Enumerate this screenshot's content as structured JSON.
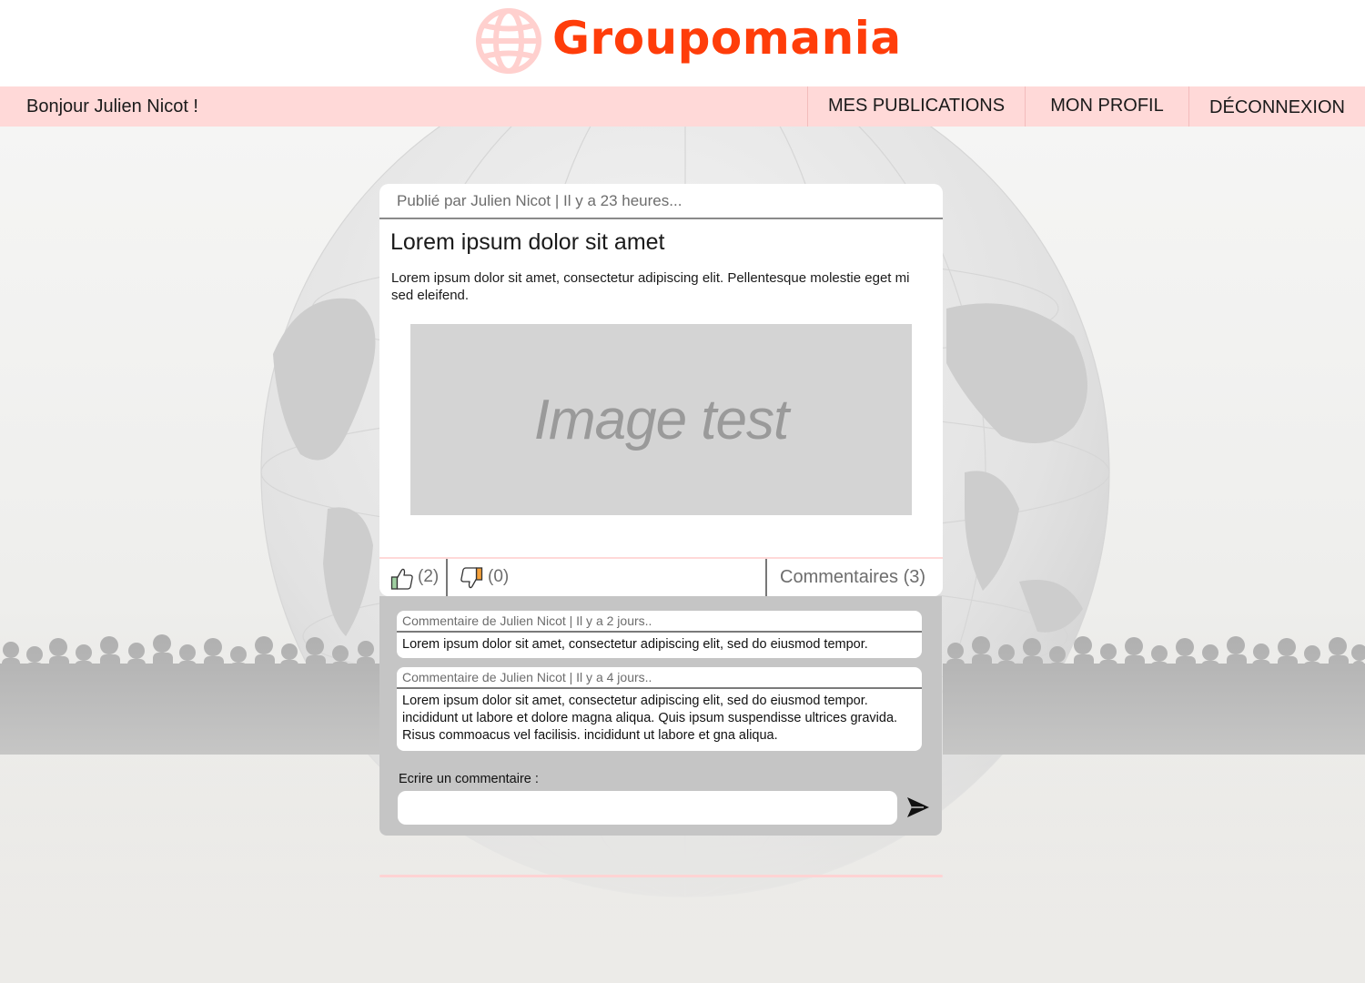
{
  "brand": {
    "name": "Groupomania",
    "accent_color": "#ff3d0a",
    "icon": "globe-icon",
    "icon_color": "#ffd0ce"
  },
  "nav": {
    "greeting": "Bonjour Julien Nicot !",
    "items": [
      {
        "label": "MES PUBLICATIONS"
      },
      {
        "label": "MON PROFIL"
      },
      {
        "label": "DÉCONNEXION"
      }
    ],
    "bar_color": "#ffd9d8"
  },
  "post": {
    "meta": "Publié par Julien Nicot | Il y a 23 heures...",
    "title": "Lorem ipsum dolor sit amet",
    "body": "Lorem ipsum dolor sit amet, consectetur adipiscing elit. Pellentesque molestie eget mi sed eleifend.",
    "image_label": "Image test",
    "likes": "(2)",
    "dislikes": "(0)",
    "like_icon": "thumbs-up-icon",
    "dislike_icon": "thumbs-down-icon",
    "comments_label": "Commentaires (3)"
  },
  "comments": [
    {
      "meta": "Commentaire de Julien Nicot | Il y a 2 jours..",
      "text": "Lorem ipsum dolor sit amet, consectetur adipiscing elit, sed do eiusmod tempor."
    },
    {
      "meta": "Commentaire de Julien Nicot | Il y a 4 jours..",
      "text": "Lorem ipsum dolor sit amet, consectetur adipiscing elit, sed do eiusmod tempor. incididunt ut labore et dolore magna aliqua. Quis ipsum suspendisse ultrices gravida. Risus commoacus vel facilisis. incididunt ut labore et gna aliqua."
    }
  ],
  "comment_form": {
    "label": "Ecrire un commentaire :",
    "placeholder": "",
    "send_icon": "send-arrow-icon"
  }
}
